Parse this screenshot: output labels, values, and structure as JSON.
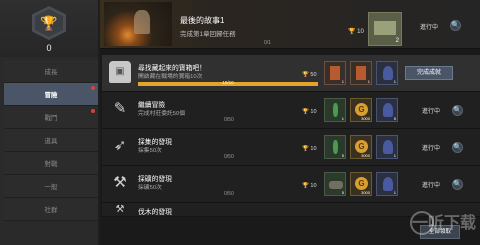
{
  "sidebar": {
    "emblem_count": "0",
    "trophy_icon": "trophy-icon",
    "items": [
      {
        "label": "成長",
        "active": false,
        "badge": false
      },
      {
        "label": "冒險",
        "active": true,
        "badge": true
      },
      {
        "label": "戰鬥",
        "active": false,
        "badge": true
      },
      {
        "label": "道具",
        "active": false,
        "badge": false
      },
      {
        "label": "對戰",
        "active": false,
        "badge": false
      },
      {
        "label": "一般",
        "active": false,
        "badge": false
      },
      {
        "label": "社群",
        "active": false,
        "badge": false
      }
    ]
  },
  "featured": {
    "title": "最後的故事1",
    "description": "完成第1章回歸任務",
    "progress": "0/1",
    "points": "10",
    "reward_qty": "2",
    "status": "進行中"
  },
  "achievements": [
    {
      "name": "尋找藏起來的寶箱吧！",
      "sub": "開啟藏在戰場的寶箱10次",
      "progress": "10/10",
      "progress_fraction": 1.0,
      "points": "50",
      "rewards": [
        {
          "type": "card",
          "qty": "1"
        },
        {
          "type": "card",
          "qty": "1"
        },
        {
          "type": "blue",
          "qty": "1"
        }
      ],
      "status": "",
      "claim_label": "完成成就",
      "icon": "treasure-chest-icon"
    },
    {
      "name": "繼續冒險",
      "sub": "完成村莊委託50個",
      "progress": "0/50",
      "progress_fraction": 0,
      "points": "10",
      "rewards": [
        {
          "type": "herb",
          "qty": "1"
        },
        {
          "type": "gold",
          "qty": "3000"
        },
        {
          "type": "blue",
          "qty": "5"
        }
      ],
      "status": "進行中",
      "icon": "scroll-icon"
    },
    {
      "name": "採集的發現",
      "sub": "採集50次",
      "progress": "0/50",
      "progress_fraction": 0,
      "points": "10",
      "rewards": [
        {
          "type": "herb",
          "qty": "5"
        },
        {
          "type": "gold",
          "qty": "3000"
        },
        {
          "type": "blue",
          "qty": "1"
        }
      ],
      "status": "進行中",
      "icon": "feather-icon"
    },
    {
      "name": "採礦的發現",
      "sub": "採礦50次",
      "progress": "0/50",
      "progress_fraction": 0,
      "points": "10",
      "rewards": [
        {
          "type": "ore",
          "qty": "5"
        },
        {
          "type": "gold",
          "qty": "3000"
        },
        {
          "type": "blue",
          "qty": "1"
        }
      ],
      "status": "進行中",
      "icon": "pickaxe-icon"
    },
    {
      "name": "伐木的發現",
      "sub": "",
      "progress": "",
      "progress_fraction": 0,
      "points": "",
      "rewards": [],
      "status": "",
      "icon": "axe-icon"
    }
  ],
  "claim_all_label": "全部領取",
  "watermark": "一听下载"
}
